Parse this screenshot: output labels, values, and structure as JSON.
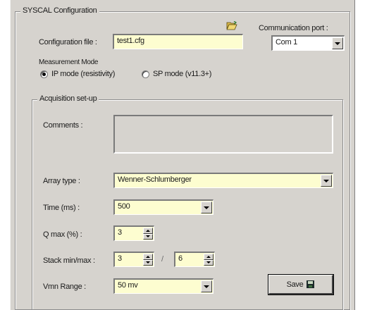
{
  "window": {
    "title": "SYSCAL Configuration"
  },
  "config": {
    "file_label": "Configuration file :",
    "file_value": "test1.cfg",
    "open_icon": "folder-open-icon"
  },
  "comm": {
    "label": "Communication port :",
    "value": "Com 1"
  },
  "measurement": {
    "label": "Measurement Mode",
    "ip_label": "IP mode (resistivity)",
    "sp_label": "SP mode (v11.3+)",
    "selected": "ip"
  },
  "acq": {
    "legend": "Acquisition set-up",
    "comments_label": "Comments :",
    "comments_value": "",
    "array_label": "Array type :",
    "array_value": "Wenner-Schlumberger",
    "time_label": "Time (ms) :",
    "time_value": "500",
    "qmax_label": "Q max (%) :",
    "qmax_value": "3",
    "stack_label": "Stack min/max :",
    "stack_min": "3",
    "stack_sep": "/",
    "stack_max": "6",
    "vmn_label": "Vmn Range :",
    "vmn_value": "50 mv",
    "save_label": "Save",
    "save_icon": "floppy-disk-icon"
  }
}
